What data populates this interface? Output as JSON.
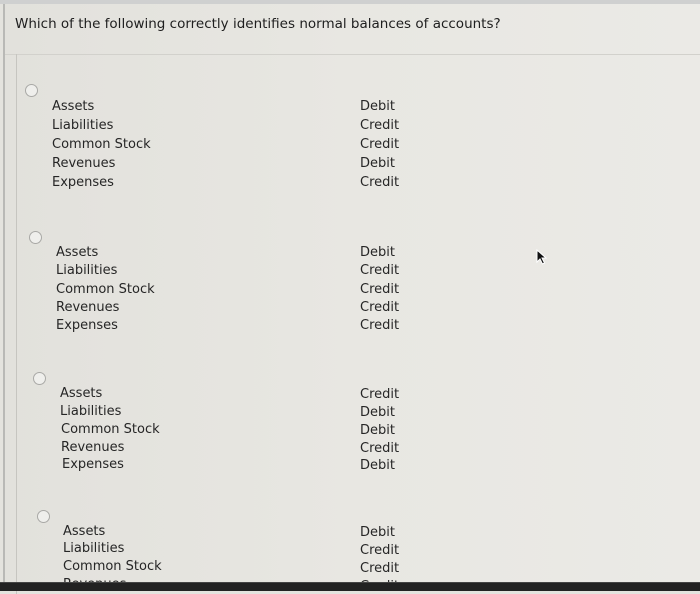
{
  "question": {
    "text": "Which of the following correctly identifies normal balances of accounts?"
  },
  "options": [
    {
      "rows": [
        {
          "account": "Assets",
          "balance": "Debit"
        },
        {
          "account": "Liabilities",
          "balance": "Credit"
        },
        {
          "account": "Common Stock",
          "balance": "Credit"
        },
        {
          "account": "Revenues",
          "balance": "Debit"
        },
        {
          "account": "Expenses",
          "balance": "Credit"
        }
      ],
      "selected": false
    },
    {
      "rows": [
        {
          "account": "Assets",
          "balance": "Debit"
        },
        {
          "account": "Liabilities",
          "balance": "Credit"
        },
        {
          "account": "Common Stock",
          "balance": "Credit"
        },
        {
          "account": "Revenues",
          "balance": "Credit"
        },
        {
          "account": "Expenses",
          "balance": "Credit"
        }
      ],
      "selected": false
    },
    {
      "rows": [
        {
          "account": "Assets",
          "balance": "Credit"
        },
        {
          "account": "Liabilities",
          "balance": "Debit"
        },
        {
          "account": "Common Stock",
          "balance": "Debit"
        },
        {
          "account": "Revenues",
          "balance": "Credit"
        },
        {
          "account": "Expenses",
          "balance": "Debit"
        }
      ],
      "selected": false
    },
    {
      "rows": [
        {
          "account": "Assets",
          "balance": "Debit"
        },
        {
          "account": "Liabilities",
          "balance": "Credit"
        },
        {
          "account": "Common Stock",
          "balance": "Credit"
        },
        {
          "account": "Revenues",
          "balance": "Credit"
        }
      ],
      "selected": false
    }
  ],
  "cursor": {
    "icon": "mouse-pointer-icon"
  }
}
